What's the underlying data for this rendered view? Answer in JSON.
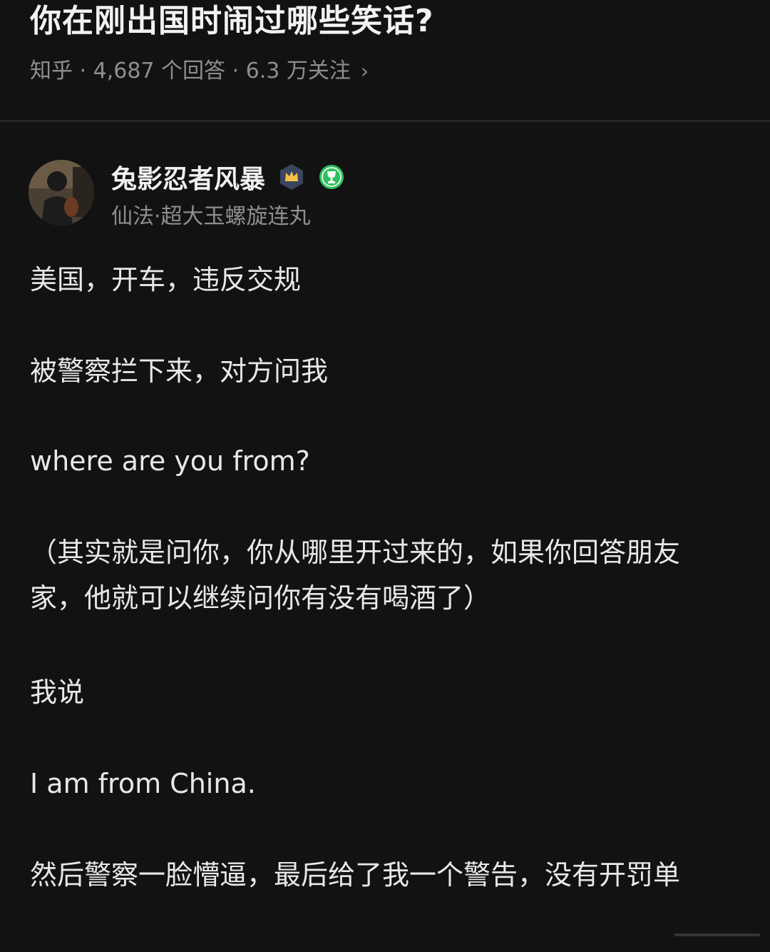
{
  "question": {
    "title": "你在刚出国时闹过哪些笑话?",
    "meta": "知乎 · 4,687 个回答 · 6.3 万关注",
    "chevron": "›"
  },
  "author": {
    "name": "兔影忍者风暴",
    "headline": "仙法·超大玉螺旋连丸",
    "badges": [
      "crown-badge-icon",
      "trophy-badge-icon"
    ]
  },
  "answer": {
    "paragraphs": [
      "美国，开车，违反交规",
      "被警察拦下来，对方问我",
      "where are you from?",
      "（其实就是问你，你从哪里开过来的，如果你回答朋友家，他就可以继续问你有没有喝酒了）",
      "我说",
      "I am from China.",
      "然后警察一脸懵逼，最后给了我一个警告，没有开罚单"
    ]
  },
  "colors": {
    "background": "#121212",
    "text_primary": "#e8e8e8",
    "text_secondary": "#8e8e8e",
    "divider": "#262626",
    "badge_crown_bg": "#3b4560",
    "badge_trophy": "#2fbf5f"
  }
}
